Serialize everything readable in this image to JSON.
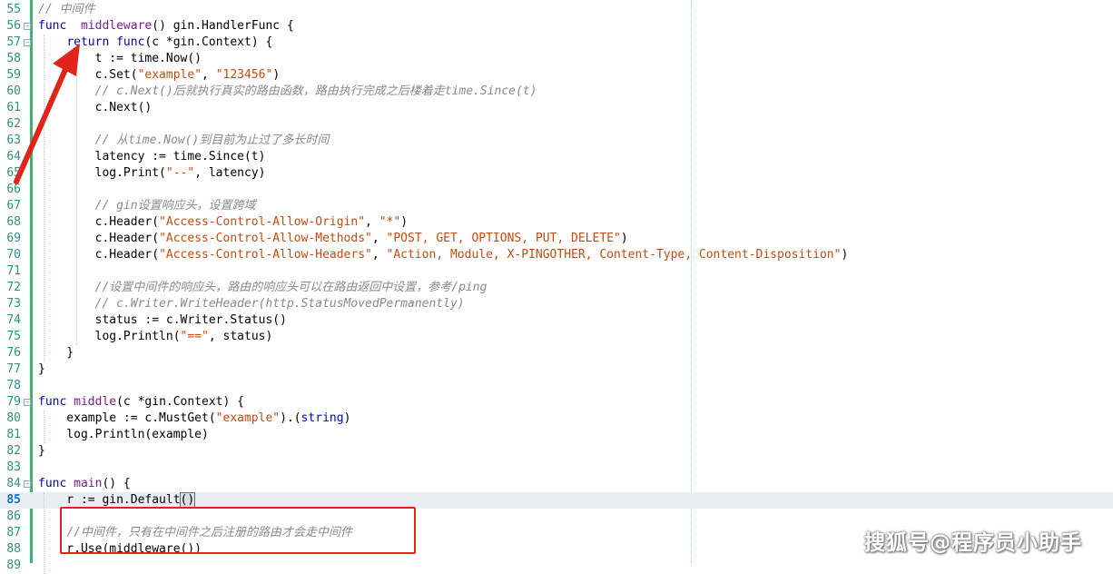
{
  "editor": {
    "lines": [
      {
        "n": "55",
        "segs": [
          [
            "cmt",
            "// 中间件"
          ]
        ]
      },
      {
        "n": "56",
        "fold": true,
        "segs": [
          [
            "kw",
            "func"
          ],
          [
            "",
            "  "
          ],
          [
            "fn",
            "middleware"
          ],
          [
            "",
            "() gin.HandlerFunc {"
          ]
        ]
      },
      {
        "n": "57",
        "fold": true,
        "segs": [
          [
            "",
            "    "
          ],
          [
            "kw",
            "return"
          ],
          [
            "",
            " "
          ],
          [
            "kw",
            "func"
          ],
          [
            "",
            "(c *gin.Context) {"
          ]
        ]
      },
      {
        "n": "58",
        "segs": [
          [
            "",
            "        t := time.Now()"
          ]
        ]
      },
      {
        "n": "59",
        "segs": [
          [
            "",
            "        c.Set("
          ],
          [
            "str",
            "\"example\""
          ],
          [
            "",
            ", "
          ],
          [
            "str",
            "\"123456\""
          ],
          [
            "",
            ")"
          ]
        ]
      },
      {
        "n": "60",
        "segs": [
          [
            "",
            "        "
          ],
          [
            "cmt",
            "// c.Next()后就执行真实的路由函数，路由执行完成之后楼着走time.Since(t)"
          ]
        ]
      },
      {
        "n": "61",
        "segs": [
          [
            "",
            "        c.Next()"
          ]
        ]
      },
      {
        "n": "62",
        "segs": [
          [
            "",
            ""
          ]
        ]
      },
      {
        "n": "63",
        "segs": [
          [
            "",
            "        "
          ],
          [
            "cmt",
            "// 从time.Now()到目前为止过了多长时间"
          ]
        ]
      },
      {
        "n": "64",
        "segs": [
          [
            "",
            "        latency := time.Since(t)"
          ]
        ]
      },
      {
        "n": "65",
        "segs": [
          [
            "",
            "        log.Print("
          ],
          [
            "str",
            "\"--\""
          ],
          [
            "",
            ", latency)"
          ]
        ]
      },
      {
        "n": "66",
        "segs": [
          [
            "",
            ""
          ]
        ]
      },
      {
        "n": "67",
        "segs": [
          [
            "",
            "        "
          ],
          [
            "cmt",
            "// gin设置响应头，设置跨域"
          ]
        ]
      },
      {
        "n": "68",
        "segs": [
          [
            "",
            "        c.Header("
          ],
          [
            "str",
            "\"Access-Control-Allow-Origin\""
          ],
          [
            "",
            ", "
          ],
          [
            "str",
            "\"*\""
          ],
          [
            "",
            ")"
          ]
        ]
      },
      {
        "n": "69",
        "segs": [
          [
            "",
            "        c.Header("
          ],
          [
            "str",
            "\"Access-Control-Allow-Methods\""
          ],
          [
            "",
            ", "
          ],
          [
            "str",
            "\"POST, GET, OPTIONS, PUT, DELETE\""
          ],
          [
            "",
            ")"
          ]
        ]
      },
      {
        "n": "70",
        "segs": [
          [
            "",
            "        c.Header("
          ],
          [
            "str",
            "\"Access-Control-Allow-Headers\""
          ],
          [
            "",
            ", "
          ],
          [
            "str",
            "\"Action, Module, X-PINGOTHER, Content-Type, Content-Disposition\""
          ],
          [
            "",
            ")"
          ]
        ]
      },
      {
        "n": "71",
        "segs": [
          [
            "",
            ""
          ]
        ]
      },
      {
        "n": "72",
        "segs": [
          [
            "",
            "        "
          ],
          [
            "cmt",
            "//设置中间件的响应头，路由的响应头可以在路由返回中设置，参考/ping"
          ]
        ]
      },
      {
        "n": "73",
        "segs": [
          [
            "",
            "        "
          ],
          [
            "cmt",
            "// c.Writer.WriteHeader(http.StatusMovedPermanently)"
          ]
        ]
      },
      {
        "n": "74",
        "segs": [
          [
            "",
            "        status := c.Writer.Status()"
          ]
        ]
      },
      {
        "n": "75",
        "segs": [
          [
            "",
            "        log.Println("
          ],
          [
            "str",
            "\"==\""
          ],
          [
            "",
            ", status)"
          ]
        ]
      },
      {
        "n": "76",
        "segs": [
          [
            "",
            "    }"
          ]
        ]
      },
      {
        "n": "77",
        "segs": [
          [
            "",
            "}"
          ]
        ]
      },
      {
        "n": "78",
        "segs": [
          [
            "",
            ""
          ]
        ]
      },
      {
        "n": "79",
        "fold": true,
        "segs": [
          [
            "kw",
            "func"
          ],
          [
            "",
            " "
          ],
          [
            "fn",
            "middle"
          ],
          [
            "",
            "(c *gin.Context) {"
          ]
        ]
      },
      {
        "n": "80",
        "segs": [
          [
            "",
            "    example := c.MustGet("
          ],
          [
            "str",
            "\"example\""
          ],
          [
            "",
            ")."
          ],
          [
            "",
            "("
          ],
          [
            "type",
            "string"
          ],
          [
            "",
            ")"
          ]
        ]
      },
      {
        "n": "81",
        "segs": [
          [
            "",
            "    log.Println(example)"
          ]
        ]
      },
      {
        "n": "82",
        "segs": [
          [
            "",
            "}"
          ]
        ]
      },
      {
        "n": "83",
        "segs": [
          [
            "",
            ""
          ]
        ]
      },
      {
        "n": "84",
        "fold": true,
        "segs": [
          [
            "kw",
            "func"
          ],
          [
            "",
            " "
          ],
          [
            "fn",
            "main"
          ],
          [
            "",
            "() {"
          ]
        ]
      },
      {
        "n": "85",
        "current": true,
        "segs": [
          [
            "",
            "    r := gin.Default"
          ],
          [
            "cursor",
            "()"
          ]
        ]
      },
      {
        "n": "86",
        "segs": [
          [
            "",
            ""
          ]
        ]
      },
      {
        "n": "87",
        "segs": [
          [
            "",
            "    "
          ],
          [
            "cmt",
            "//中间件，只有在中间件之后注册的路由才会走中间件"
          ]
        ]
      },
      {
        "n": "88",
        "segs": [
          [
            "",
            "    r.Use(middleware())"
          ]
        ]
      },
      {
        "n": "89",
        "segs": [
          [
            "",
            ""
          ]
        ]
      }
    ]
  },
  "watermark": {
    "text": "搜狐号@程序员小助手"
  },
  "colors": {
    "annotation": "#e2231a",
    "linenumber": "#2f8f86",
    "gutter_bar": "#3cb371"
  }
}
